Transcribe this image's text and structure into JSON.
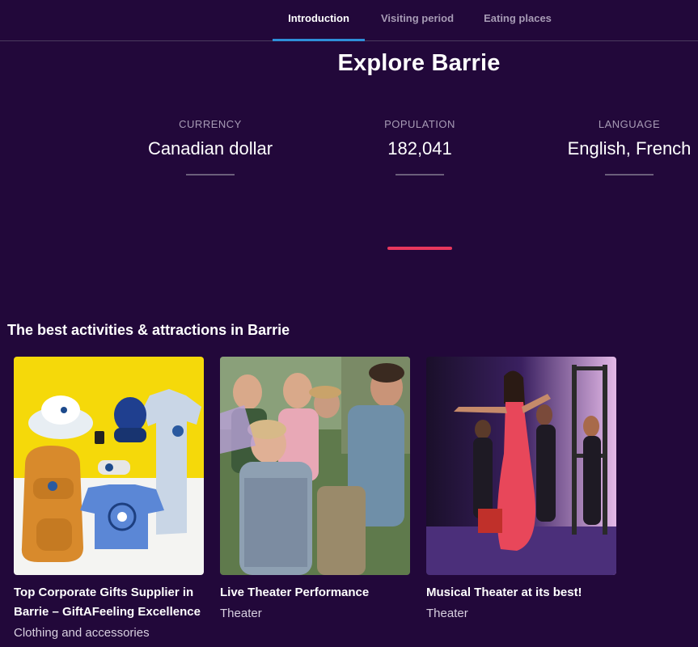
{
  "tabs": [
    "Introduction",
    "Visiting period",
    "Eating places"
  ],
  "page_title": "Explore Barrie",
  "facts": [
    {
      "label": "CURRENCY",
      "value": "Canadian dollar"
    },
    {
      "label": "POPULATION",
      "value": "182,041"
    },
    {
      "label": "LANGUAGE",
      "value": "English, French"
    }
  ],
  "section_title": "The best activities & attractions in Barrie",
  "cards": [
    {
      "title": "Top Corporate Gifts Supplier in Barrie – GiftAFeeling Excellence",
      "category": "Clothing and accessories"
    },
    {
      "title": "Live Theater Performance",
      "category": "Theater"
    },
    {
      "title": "Musical Theater at its best!",
      "category": "Theater"
    }
  ],
  "colors": {
    "background": "#22083a",
    "accent": "#e8375d",
    "tab_underline": "#2e8fd9"
  }
}
